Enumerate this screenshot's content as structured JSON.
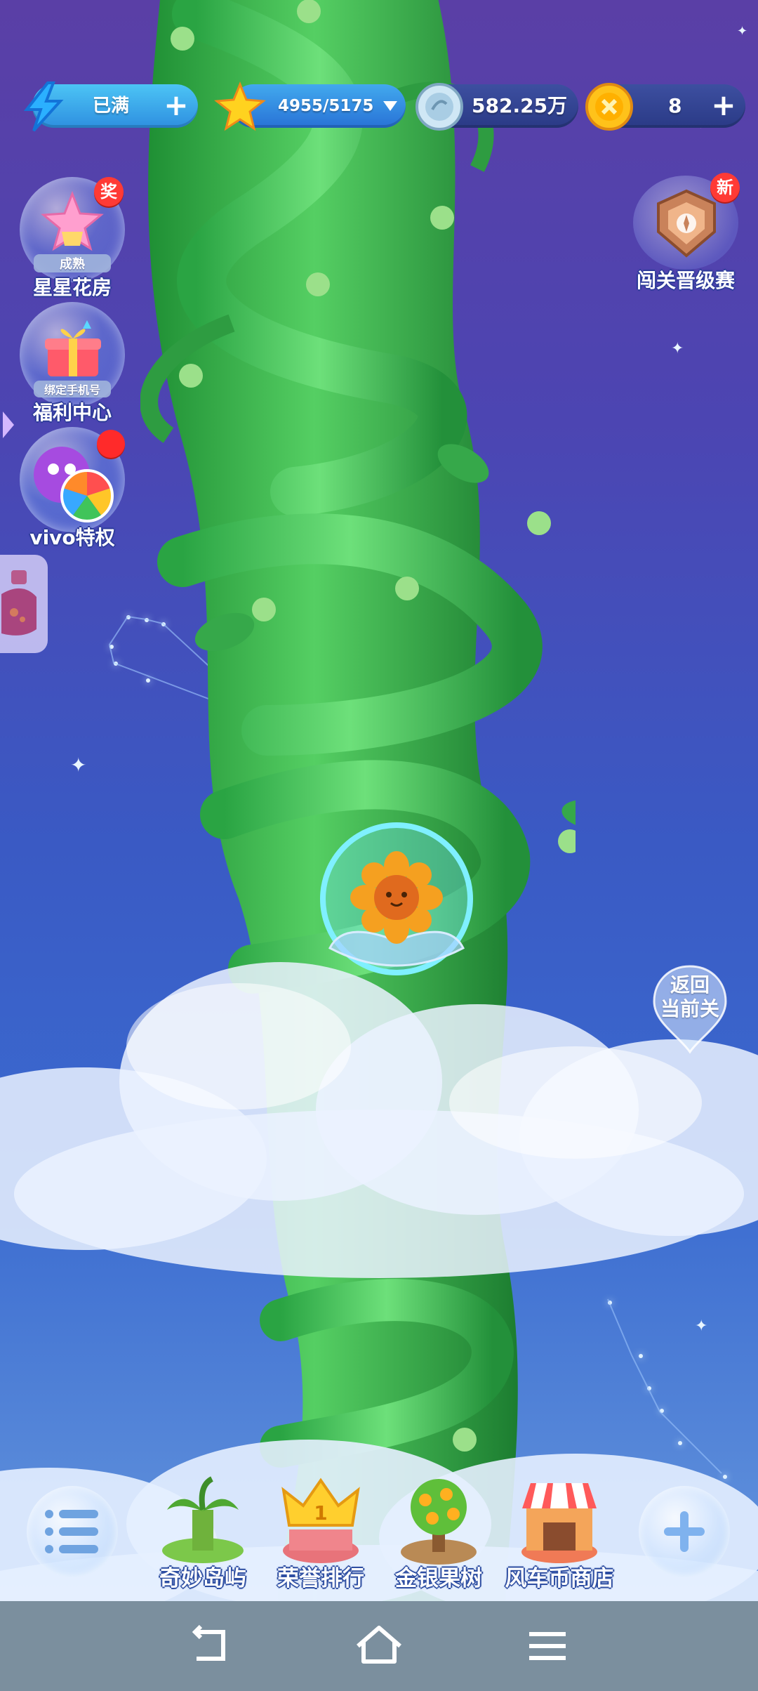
{
  "top_bar": {
    "energy": {
      "text": "已满",
      "icon": "lightning-icon"
    },
    "stars": {
      "text": "4955/5175",
      "icon": "star-icon"
    },
    "silver_coins": {
      "text": "582.25万",
      "icon": "silver-coin-icon"
    },
    "gold_coins": {
      "text": "8",
      "icon": "gold-coin-icon"
    }
  },
  "left_menu": [
    {
      "label": "星星花房",
      "sub_label": "成熟",
      "badge": "奖",
      "icon": "star-flower-house-icon"
    },
    {
      "label": "福利中心",
      "sub_label": "绑定手机号",
      "icon": "gift-box-icon"
    },
    {
      "label": "vivo特权",
      "icon": "vivo-privilege-icon"
    }
  ],
  "right_menu": {
    "label": "闯关晋级赛",
    "badge": "新",
    "icon": "tournament-badge-icon"
  },
  "return_button": {
    "line1": "返回",
    "line2": "当前关"
  },
  "bottom_nav": {
    "items": [
      {
        "label": "奇妙岛屿",
        "icon": "island-icon"
      },
      {
        "label": "荣誉排行",
        "icon": "crown-icon",
        "rank": "1"
      },
      {
        "label": "金银果树",
        "icon": "fruit-tree-icon"
      },
      {
        "label": "风车币商店",
        "icon": "shop-icon"
      }
    ]
  },
  "colors": {
    "sky_top": "#5a3fa6",
    "sky_bottom": "#3b6bd0",
    "beanstalk": "#3ab24a",
    "badge_red": "#ff3a35"
  }
}
